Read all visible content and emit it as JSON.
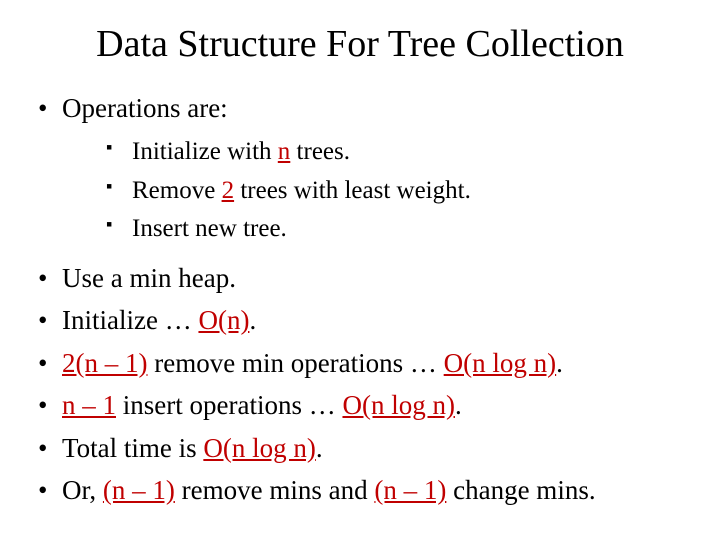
{
  "title": "Data Structure For Tree Collection",
  "l1": {
    "ops": "Operations are:",
    "heap": "Use a min heap.",
    "init_a": "Initialize … ",
    "init_b": "O(n)",
    "init_c": ".",
    "rem_a": "2(n – 1)",
    "rem_b": " remove min operations … ",
    "rem_c": "O(n log n)",
    "rem_d": ".",
    "ins_a": "n – 1",
    "ins_b": " insert operations … ",
    "ins_c": "O(n log n)",
    "ins_d": ".",
    "tot_a": "Total time is ",
    "tot_b": "O(n log n)",
    "tot_c": ".",
    "or_a": "Or, ",
    "or_b": "(n – 1)",
    "or_c": " remove mins and ",
    "or_d": "(n – 1)",
    "or_e": " change mins."
  },
  "l2": {
    "a1": "Initialize with ",
    "a2": "n",
    "a3": " trees.",
    "b1": "Remove ",
    "b2": "2",
    "b3": " trees with least weight.",
    "c": "Insert new tree."
  }
}
